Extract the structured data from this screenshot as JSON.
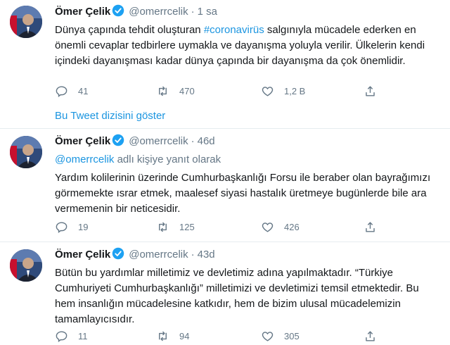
{
  "colors": {
    "link": "#1b95e0",
    "secondary": "#657786",
    "text": "#14171a",
    "verified": "#1da1f2"
  },
  "tweets": [
    {
      "name": "Ömer Çelik",
      "handle": "@omerrcelik",
      "sep": "·",
      "time": "1 sa",
      "text_pre": "Dünya çapında tehdit oluşturan ",
      "hashtag": "#coronavirüs",
      "text_post": " salgınıyla mücadele ederken en önemli cevaplar tedbirlere uymakla ve dayanışma yoluyla verilir. Ülkelerin kendi içindeki dayanışması kadar dünya çapında bir dayanışma da çok önemlidir.",
      "replies": "41",
      "retweets": "470",
      "likes": "1,2 B"
    },
    {
      "name": "Ömer Çelik",
      "handle": "@omerrcelik",
      "sep": "·",
      "time": "46d",
      "reply_mention": "@omerrcelik",
      "reply_suffix": " adlı kişiye yanıt olarak",
      "text": "Yardım kolilerinin üzerinde Cumhurbaşkanlığı Forsu ile beraber olan bayrağımızı görmemekte ısrar etmek, maalesef siyasi hastalık üretmeye bugünlerde bile ara vermemenin bir neticesidir.",
      "replies": "19",
      "retweets": "125",
      "likes": "426"
    },
    {
      "name": "Ömer Çelik",
      "handle": "@omerrcelik",
      "sep": "·",
      "time": "43d",
      "text": "Bütün bu yardımlar milletimiz ve devletimiz adına yapılmaktadır. “Türkiye Cumhuriyeti Cumhurbaşkanlığı” milletimizi ve devletimizi temsil etmektedir. Bu hem insanlığın mücadelesine katkıdır, hem de bizim ulusal mücadelemizin tamamlayıcısıdır.",
      "replies": "11",
      "retweets": "94",
      "likes": "305"
    }
  ],
  "show_thread": "Bu Tweet dizisini göster",
  "icons": [
    "reply-icon",
    "retweet-icon",
    "like-icon",
    "share-icon",
    "verified-badge-icon"
  ]
}
